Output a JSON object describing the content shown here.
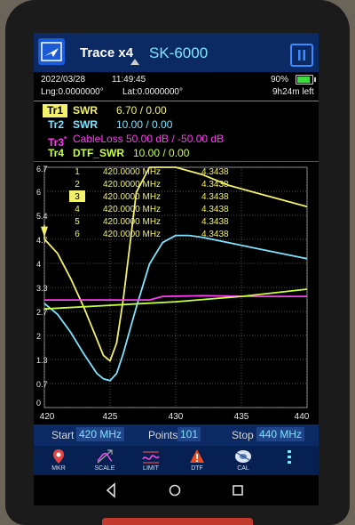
{
  "titlebar": {
    "trace_button": "Trace x4",
    "model": "SK-6000",
    "pause_icon": "pause-icon"
  },
  "status": {
    "date": "2022/03/28",
    "time": "11:49:45",
    "lng": "Lng:0.0000000°",
    "lat": "Lat:0.0000000°",
    "battery_percent": "90%",
    "battery_level": 0.9,
    "time_left": "9h24m left"
  },
  "traces": [
    {
      "tag": "Tr1",
      "type": "SWR",
      "value": "6.70 / 0.00",
      "color": "#f3f26a"
    },
    {
      "tag": "Tr2",
      "type": "SWR",
      "value": "10.00 / 0.00",
      "color": "#7fe4ff"
    },
    {
      "tag": "Tr3",
      "type": "CableLoss",
      "value": "50.00 dB / -50.00 dB",
      "color": "#ff3df4",
      "superscript": "*"
    },
    {
      "tag": "Tr4",
      "type": "DTF_SWR",
      "value": "10.00 / 0.00",
      "color": "#c8ff3d"
    }
  ],
  "markers": [
    {
      "num": "1",
      "freq": "420.0000 MHz",
      "value": "4.3438"
    },
    {
      "num": "2",
      "freq": "420.0000 MHz",
      "value": "4.3438"
    },
    {
      "num": "3",
      "freq": "420.0000 MHz",
      "value": "4.3438"
    },
    {
      "num": "4",
      "freq": "420.0000 MHz",
      "value": "4.3438"
    },
    {
      "num": "5",
      "freq": "420.0000 MHz",
      "value": "4.3438"
    },
    {
      "num": "6",
      "freq": "420.0000 MHz",
      "value": "4.3438"
    }
  ],
  "chart_data": {
    "type": "line",
    "xlim": [
      420,
      440
    ],
    "ylim": [
      0,
      6.7
    ],
    "x_ticks": [
      "420",
      "425",
      "430",
      "435",
      "440"
    ],
    "y_ticks": [
      "6.7",
      "6",
      "5.4",
      "4.7",
      "4",
      "3.3",
      "2.7",
      "2",
      "1.3",
      "0.7",
      "0"
    ],
    "grid": true,
    "series": [
      {
        "name": "Tr1",
        "color": "#f3f26a",
        "x": [
          420,
          421,
          422,
          423,
          424,
          424.5,
          425,
          425.5,
          426,
          426.5,
          427,
          428,
          429,
          430,
          432,
          434,
          436,
          438,
          440
        ],
        "y": [
          4.7,
          4.3,
          3.6,
          2.8,
          1.9,
          1.45,
          1.3,
          1.8,
          3.0,
          4.5,
          6.0,
          6.7,
          6.7,
          6.7,
          6.5,
          6.2,
          6.0,
          5.8,
          5.6
        ]
      },
      {
        "name": "Tr2",
        "color": "#7fe4ff",
        "x": [
          420,
          421,
          422,
          423,
          424,
          424.5,
          425,
          425.5,
          426,
          427,
          428,
          429,
          430,
          431,
          432,
          434,
          436,
          438,
          440
        ],
        "y": [
          2.9,
          2.6,
          2.1,
          1.5,
          0.95,
          0.8,
          0.75,
          0.95,
          1.5,
          2.8,
          4.0,
          4.6,
          4.8,
          4.8,
          4.75,
          4.6,
          4.45,
          4.3,
          4.15
        ]
      },
      {
        "name": "Tr3",
        "color": "#ff3df4",
        "x": [
          420,
          424,
          428,
          429,
          432,
          436,
          440
        ],
        "y": [
          3.0,
          3.0,
          3.0,
          3.1,
          3.12,
          3.1,
          3.1
        ]
      },
      {
        "name": "Tr4",
        "color": "#c8ff3d",
        "x": [
          420,
          425,
          430,
          435,
          440
        ],
        "y": [
          2.75,
          2.85,
          2.95,
          3.1,
          3.3
        ]
      }
    ],
    "active_marker": "3",
    "marker_arrow_y": 4.7
  },
  "controls": {
    "start_label": "Start",
    "start_value": "420 MHz",
    "points_label": "Points",
    "points_value": "101",
    "stop_label": "Stop",
    "stop_value": "440 MHz"
  },
  "menu": [
    {
      "label": "MKR",
      "icon": "marker-pin-icon"
    },
    {
      "label": "SCALE",
      "icon": "scale-icon"
    },
    {
      "label": "LIMIT",
      "icon": "limit-icon"
    },
    {
      "label": "DTF",
      "icon": "dtf-icon"
    },
    {
      "label": "CAL",
      "icon": "calibrate-icon"
    },
    {
      "label": "",
      "icon": "more-vertical-icon"
    }
  ],
  "nav": {
    "back_icon": "back-icon",
    "home_icon": "home-icon",
    "recents_icon": "recents-icon"
  }
}
